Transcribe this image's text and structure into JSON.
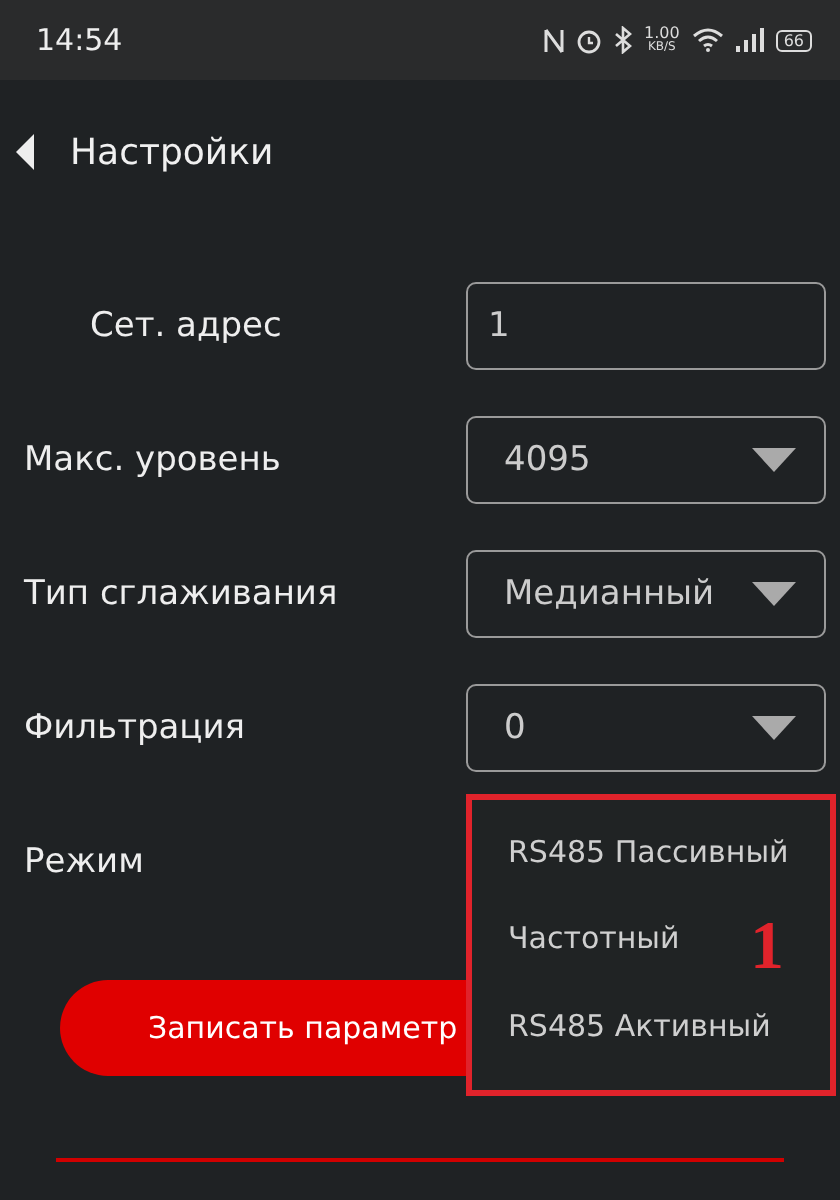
{
  "status_bar": {
    "time": "14:54",
    "speed_value": "1.00",
    "speed_unit": "KB/S",
    "battery": "66"
  },
  "header": {
    "title": "Настройки"
  },
  "fields": [
    {
      "kind": "input",
      "label": "Сет. адрес",
      "value": "1"
    },
    {
      "kind": "select",
      "label": "Макс. уровень",
      "value": "4095"
    },
    {
      "kind": "select",
      "label": "Тип сглаживания",
      "value": "Медианный"
    },
    {
      "kind": "select",
      "label": "Фильтрация",
      "value": "0"
    },
    {
      "kind": "menu",
      "label": "Режим"
    }
  ],
  "mode_menu": {
    "options": [
      "RS485 Пассивный",
      "Частотный",
      "RS485 Активный"
    ],
    "callout": "1"
  },
  "save_button": "Записать параметр"
}
